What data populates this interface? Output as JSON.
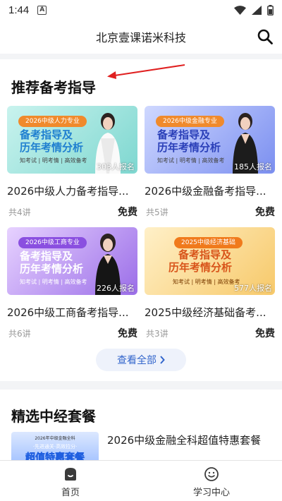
{
  "status_bar": {
    "time": "1:44",
    "notif_glyph": "A"
  },
  "header": {
    "title": "北京壹课诺米科技"
  },
  "section1": {
    "title": "推荐备考指导",
    "view_all": "查看全部"
  },
  "courses": [
    {
      "badge": "2026中级人力专业",
      "line1": "备考指导及",
      "line2": "历年考情分析",
      "tags": "知考试 | 明考情 | 高效备考",
      "count": "303人报名",
      "name": "2026中级人力备考指导...",
      "lessons": "共4讲",
      "price": "免费"
    },
    {
      "badge": "2026中级金融专业",
      "line1": "备考指导及",
      "line2": "历年考情分析",
      "tags": "知考试 | 明考情 | 高效备考",
      "count": "185人报名",
      "name": "2026中级金融备考指导...",
      "lessons": "共5讲",
      "price": "免费"
    },
    {
      "badge": "2026中级工商专业",
      "line1": "备考指导及",
      "line2": "历年考情分析",
      "tags": "知考试 | 明考情 | 高效备考",
      "count": "226人报名",
      "name": "2026中级工商备考指导...",
      "lessons": "共6讲",
      "price": "免费"
    },
    {
      "badge": "2025中级经济基础",
      "line1": "备考指导及",
      "line2": "历年考情分析",
      "tags": "知考试 | 明考情 | 高效备考",
      "count": "577人报名",
      "name": "2025中级经济基础备考...",
      "lessons": "共3讲",
      "price": "免费"
    }
  ],
  "section2": {
    "title": "精选中经套餐",
    "package": {
      "thumb_top": "2026年中级金融全科",
      "thumb_mid": "·先进通关·高效拉分·",
      "thumb_big": "超值特惠套餐",
      "name": "2026中级金融全科超值特惠套餐"
    }
  },
  "tabbar": {
    "home": "首页",
    "study": "学习中心"
  },
  "colors": {
    "accent": "#3366cc",
    "annotation_arrow": "#e02020"
  },
  "icons": [
    "search-icon",
    "home-icon",
    "smile-icon",
    "wifi-icon",
    "signal-icon",
    "battery-icon",
    "chevron-right-icon"
  ]
}
